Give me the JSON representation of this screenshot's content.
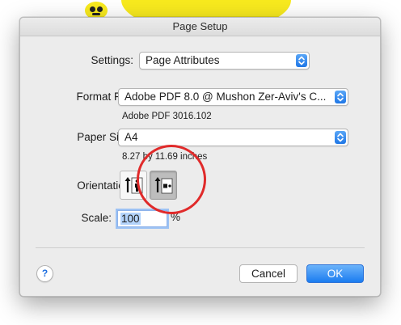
{
  "window": {
    "title": "Page Setup"
  },
  "settings": {
    "label": "Settings:",
    "value": "Page Attributes"
  },
  "format": {
    "label": "Format For:",
    "value": "Adobe PDF 8.0 @ Mushon Zer-Aviv's C...",
    "detail": "Adobe PDF 3016.102"
  },
  "paper": {
    "label": "Paper Size:",
    "value": "A4",
    "dimensions": "8.27 by 11.69 inches"
  },
  "orientation": {
    "label": "Orientation:",
    "options": [
      {
        "icon": "portrait-orientation-icon",
        "selected": false
      },
      {
        "icon": "landscape-orientation-icon",
        "selected": true
      }
    ]
  },
  "scale": {
    "label": "Scale:",
    "value": "100",
    "unit": "%"
  },
  "buttons": {
    "help": "?",
    "cancel": "Cancel",
    "ok": "OK"
  },
  "colors": {
    "accent": "#1b7cf0",
    "annotation": "#e02a2a",
    "background_art": "#f8ea1e"
  }
}
